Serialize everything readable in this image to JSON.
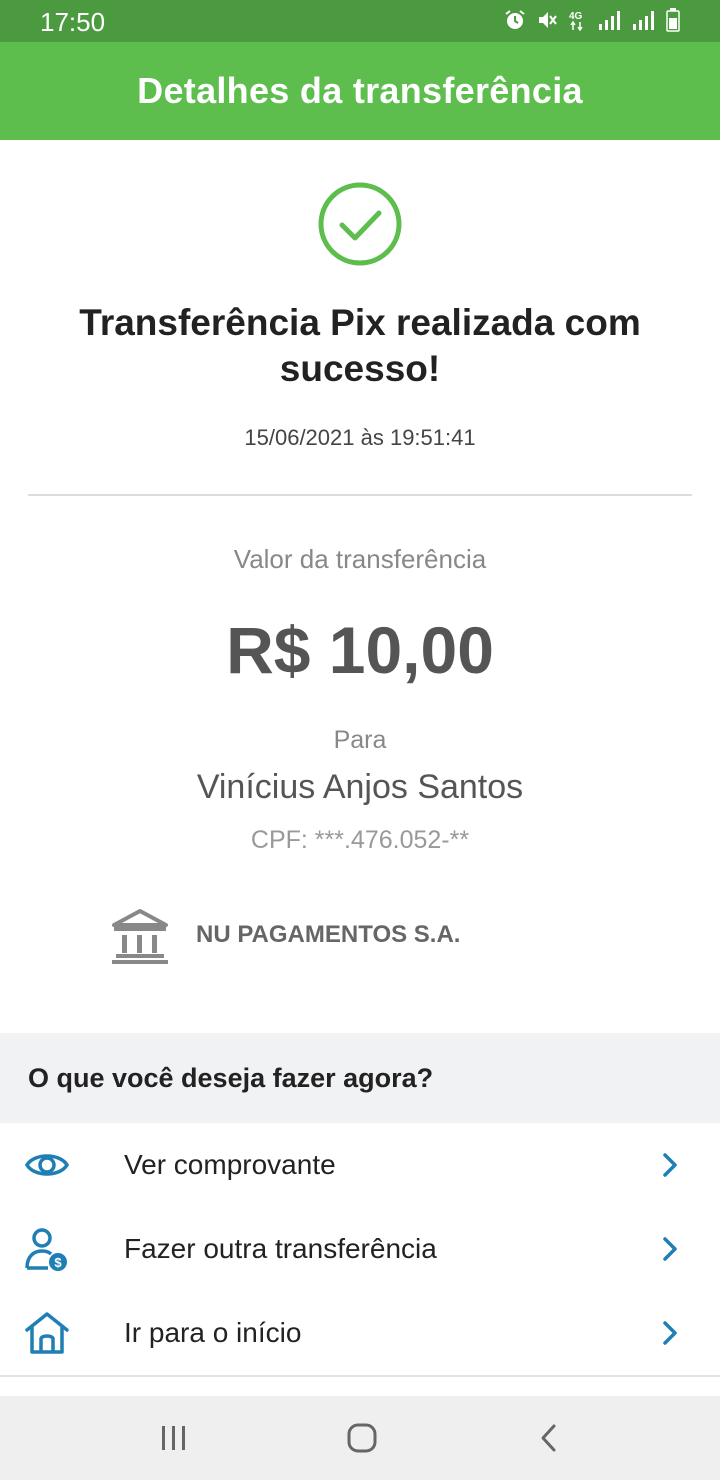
{
  "status_bar": {
    "time": "17:50",
    "icons": [
      "alarm-icon",
      "mute-icon",
      "4g-icon",
      "signal-icon",
      "signal-icon",
      "battery-icon"
    ]
  },
  "header": {
    "title": "Detalhes da transferência"
  },
  "result": {
    "icon": "check-circle-icon",
    "title": "Transferência Pix realizada com sucesso!",
    "timestamp": "15/06/2021 às 19:51:41"
  },
  "transfer": {
    "value_label": "Valor da transferência",
    "amount": "R$ 10,00",
    "to_label": "Para",
    "recipient_name": "Vinícius Anjos Santos",
    "recipient_cpf": "CPF: ***.476.052-**",
    "bank_icon": "bank-icon",
    "bank_name": "NU PAGAMENTOS S.A."
  },
  "actions": {
    "section_title": "O que você deseja fazer agora?",
    "items": [
      {
        "label": "Ver comprovante",
        "icon": "eye-icon"
      },
      {
        "label": "Fazer outra transferência",
        "icon": "person-money-icon"
      },
      {
        "label": "Ir para o início",
        "icon": "home-icon"
      }
    ]
  },
  "nav": {
    "buttons": [
      "recent-apps-icon",
      "home-nav-icon",
      "back-icon"
    ]
  },
  "colors": {
    "header_green": "#5dbd4d",
    "status_green": "#4b9a3f",
    "success_green": "#5dbd4d",
    "action_blue": "#1f7fb5"
  }
}
